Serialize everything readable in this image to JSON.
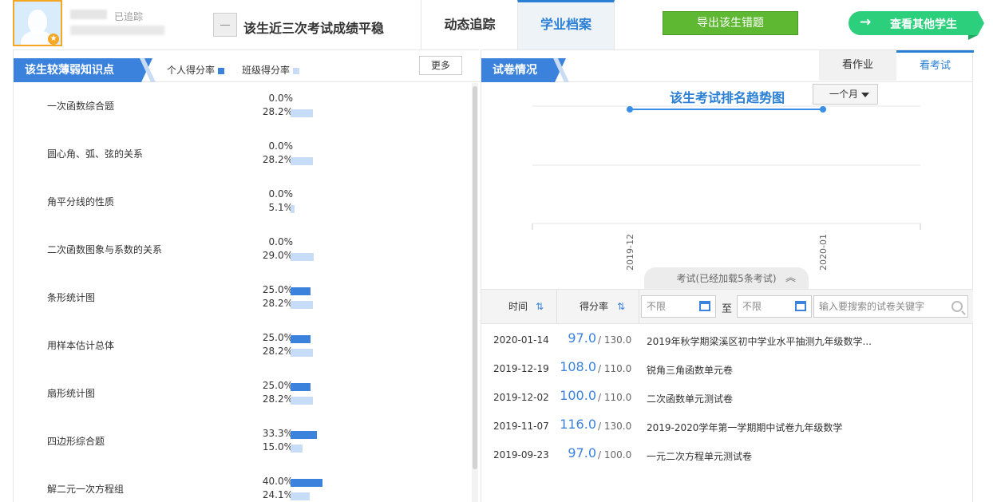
{
  "student": {
    "tracked_label": "已追踪"
  },
  "header": {
    "trend_text": "该生近三次考试成绩平稳",
    "tabs": [
      "动态追踪",
      "学业档案"
    ],
    "export_label": "导出该生错题",
    "other_students_label": "查看其他学生"
  },
  "weak_points": {
    "title": "该生较薄弱知识点",
    "legend_personal": "个人得分率",
    "legend_class": "班级得分率",
    "more_label": "更多",
    "items": [
      {
        "name": "一次函数综合题",
        "personal": "0.0%",
        "class": "28.2%",
        "personal_value": 0.0,
        "class_value": 28.2
      },
      {
        "name": "圆心角、弧、弦的关系",
        "personal": "0.0%",
        "class": "28.2%",
        "personal_value": 0.0,
        "class_value": 28.2
      },
      {
        "name": "角平分线的性质",
        "personal": "0.0%",
        "class": "5.1%",
        "personal_value": 0.0,
        "class_value": 5.1
      },
      {
        "name": "二次函数图象与系数的关系",
        "personal": "0.0%",
        "class": "29.0%",
        "personal_value": 0.0,
        "class_value": 29.0
      },
      {
        "name": "条形统计图",
        "personal": "25.0%",
        "class": "28.2%",
        "personal_value": 25.0,
        "class_value": 28.2
      },
      {
        "name": "用样本估计总体",
        "personal": "25.0%",
        "class": "28.2%",
        "personal_value": 25.0,
        "class_value": 28.2
      },
      {
        "name": "扇形统计图",
        "personal": "25.0%",
        "class": "28.2%",
        "personal_value": 25.0,
        "class_value": 28.2
      },
      {
        "name": "四边形综合题",
        "personal": "33.3%",
        "class": "15.0%",
        "personal_value": 33.3,
        "class_value": 15.0
      },
      {
        "name": "解二元一次方程组",
        "personal": "40.0%",
        "class": "24.1%",
        "personal_value": 40.0,
        "class_value": 24.1
      }
    ]
  },
  "exam": {
    "section_title": "试卷情况",
    "tabs": [
      "看作业",
      "看考试"
    ],
    "chart_title": "该生考试排名趋势图",
    "range": "一个月",
    "load_info": "考试(已经加载5条考试)",
    "filters": {
      "time_label": "时间",
      "score_label": "得分率",
      "from_placeholder": "不限",
      "to_label": "至",
      "to_placeholder": "不限",
      "search_placeholder": "输入要搜索的试卷关键字"
    },
    "rows": [
      {
        "date": "2020-01-14",
        "score": "97.0",
        "total": "/ 130.0",
        "name": "2019年秋学期梁溪区初中学业水平抽测九年级数学..."
      },
      {
        "date": "2019-12-19",
        "score": "108.0",
        "total": "/ 110.0",
        "name": "锐角三角函数单元卷"
      },
      {
        "date": "2019-12-02",
        "score": "100.0",
        "total": "/ 110.0",
        "name": "二次函数单元测试卷"
      },
      {
        "date": "2019-11-07",
        "score": "116.0",
        "total": "/ 130.0",
        "name": "2019-2020学年第一学期期中试卷九年级数学"
      },
      {
        "date": "2019-09-23",
        "score": "97.0",
        "total": "/ 100.0",
        "name": "一元二次方程单元测试卷"
      }
    ]
  },
  "chart_data": {
    "type": "line",
    "title": "该生考试排名趋势图",
    "categories": [
      "2019-12",
      "2020-01"
    ],
    "series": [
      {
        "values": [
          null,
          null
        ]
      }
    ],
    "grid": true,
    "colors": {
      "line": "#3b8ee6"
    }
  }
}
